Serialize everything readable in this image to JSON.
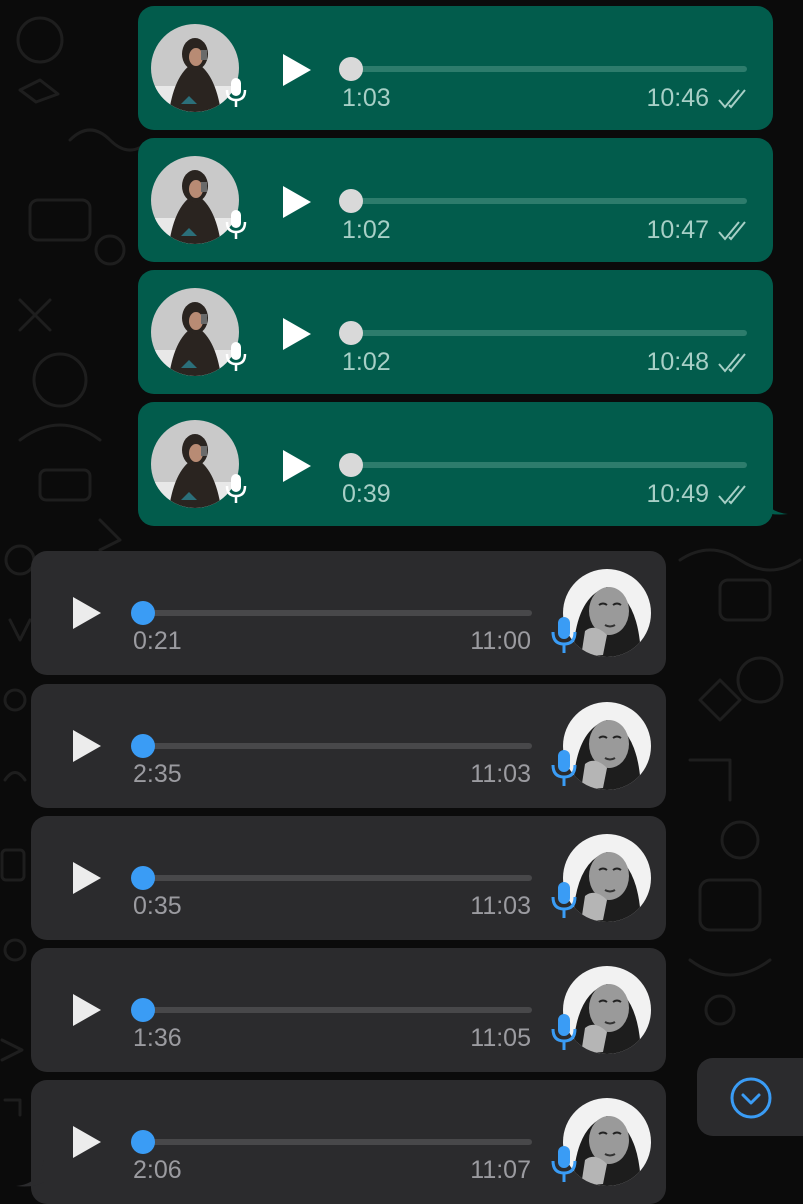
{
  "colors": {
    "background": "#0b0b0b",
    "outgoing_bubble": "#025c4c",
    "incoming_bubble": "#2b2b2d",
    "accent_blue": "#3a9cf5",
    "outgoing_meta_text": "#a7cfc6",
    "incoming_meta_text": "#9b9ba0"
  },
  "messages": [
    {
      "direction": "outgoing",
      "type": "voice",
      "duration": "1:03",
      "time": "10:46",
      "status": "read",
      "progress": 0
    },
    {
      "direction": "outgoing",
      "type": "voice",
      "duration": "1:02",
      "time": "10:47",
      "status": "read",
      "progress": 0
    },
    {
      "direction": "outgoing",
      "type": "voice",
      "duration": "1:02",
      "time": "10:48",
      "status": "read",
      "progress": 0
    },
    {
      "direction": "outgoing",
      "type": "voice",
      "duration": "0:39",
      "time": "10:49",
      "status": "read",
      "progress": 0
    },
    {
      "direction": "incoming",
      "type": "voice",
      "duration": "0:21",
      "time": "11:00",
      "progress": 0
    },
    {
      "direction": "incoming",
      "type": "voice",
      "duration": "2:35",
      "time": "11:03",
      "progress": 0
    },
    {
      "direction": "incoming",
      "type": "voice",
      "duration": "0:35",
      "time": "11:03",
      "progress": 0
    },
    {
      "direction": "incoming",
      "type": "voice",
      "duration": "1:36",
      "time": "11:05",
      "progress": 0
    },
    {
      "direction": "incoming",
      "type": "voice",
      "duration": "2:06",
      "time": "11:07",
      "progress": 0
    }
  ],
  "icons": {
    "play": "play-icon",
    "mic": "microphone-icon",
    "read_receipt": "double-check-icon",
    "scroll_down": "chevron-down-circle-icon"
  }
}
